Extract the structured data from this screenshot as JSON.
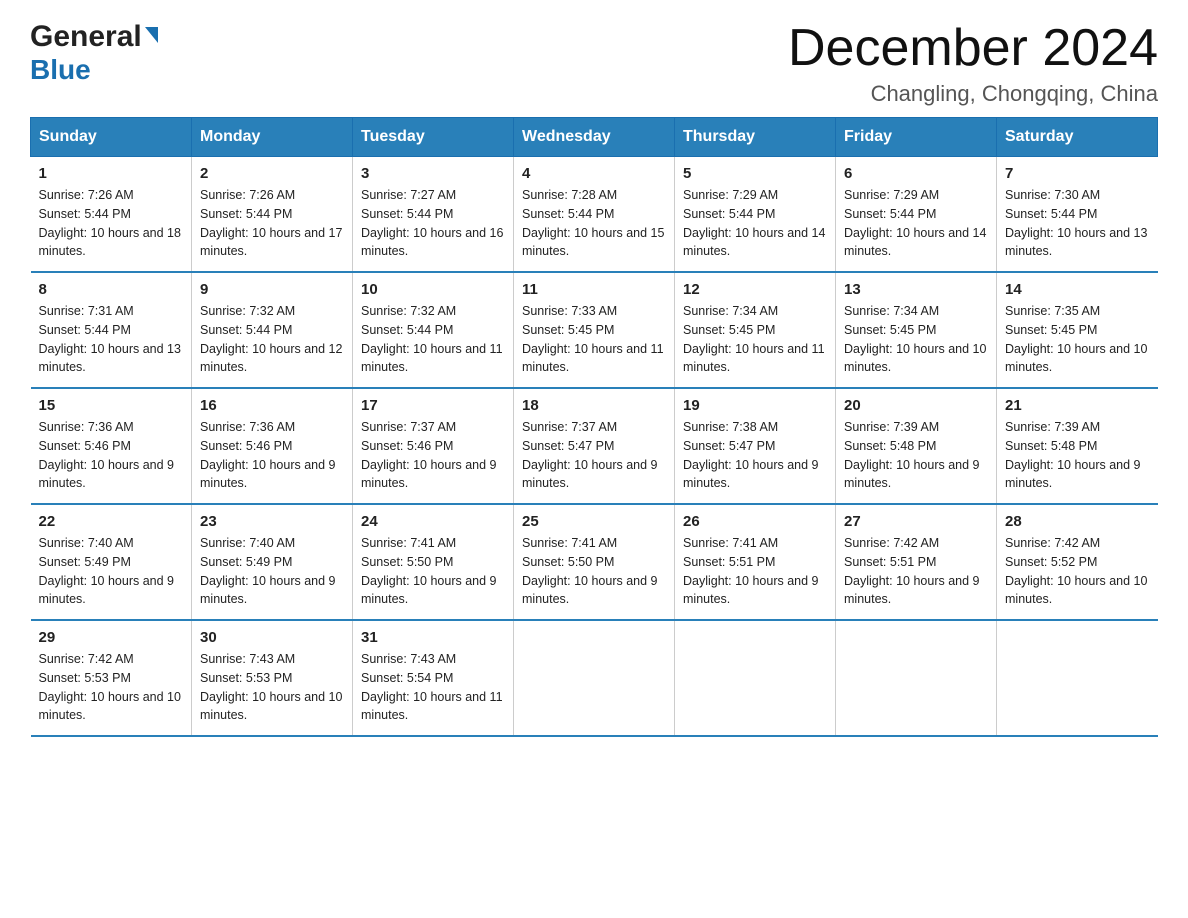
{
  "header": {
    "logo_general": "General",
    "logo_blue": "Blue",
    "month_title": "December 2024",
    "location": "Changling, Chongqing, China"
  },
  "days_of_week": [
    "Sunday",
    "Monday",
    "Tuesday",
    "Wednesday",
    "Thursday",
    "Friday",
    "Saturday"
  ],
  "weeks": [
    [
      {
        "day": "1",
        "sunrise": "7:26 AM",
        "sunset": "5:44 PM",
        "daylight": "10 hours and 18 minutes."
      },
      {
        "day": "2",
        "sunrise": "7:26 AM",
        "sunset": "5:44 PM",
        "daylight": "10 hours and 17 minutes."
      },
      {
        "day": "3",
        "sunrise": "7:27 AM",
        "sunset": "5:44 PM",
        "daylight": "10 hours and 16 minutes."
      },
      {
        "day": "4",
        "sunrise": "7:28 AM",
        "sunset": "5:44 PM",
        "daylight": "10 hours and 15 minutes."
      },
      {
        "day": "5",
        "sunrise": "7:29 AM",
        "sunset": "5:44 PM",
        "daylight": "10 hours and 14 minutes."
      },
      {
        "day": "6",
        "sunrise": "7:29 AM",
        "sunset": "5:44 PM",
        "daylight": "10 hours and 14 minutes."
      },
      {
        "day": "7",
        "sunrise": "7:30 AM",
        "sunset": "5:44 PM",
        "daylight": "10 hours and 13 minutes."
      }
    ],
    [
      {
        "day": "8",
        "sunrise": "7:31 AM",
        "sunset": "5:44 PM",
        "daylight": "10 hours and 13 minutes."
      },
      {
        "day": "9",
        "sunrise": "7:32 AM",
        "sunset": "5:44 PM",
        "daylight": "10 hours and 12 minutes."
      },
      {
        "day": "10",
        "sunrise": "7:32 AM",
        "sunset": "5:44 PM",
        "daylight": "10 hours and 11 minutes."
      },
      {
        "day": "11",
        "sunrise": "7:33 AM",
        "sunset": "5:45 PM",
        "daylight": "10 hours and 11 minutes."
      },
      {
        "day": "12",
        "sunrise": "7:34 AM",
        "sunset": "5:45 PM",
        "daylight": "10 hours and 11 minutes."
      },
      {
        "day": "13",
        "sunrise": "7:34 AM",
        "sunset": "5:45 PM",
        "daylight": "10 hours and 10 minutes."
      },
      {
        "day": "14",
        "sunrise": "7:35 AM",
        "sunset": "5:45 PM",
        "daylight": "10 hours and 10 minutes."
      }
    ],
    [
      {
        "day": "15",
        "sunrise": "7:36 AM",
        "sunset": "5:46 PM",
        "daylight": "10 hours and 9 minutes."
      },
      {
        "day": "16",
        "sunrise": "7:36 AM",
        "sunset": "5:46 PM",
        "daylight": "10 hours and 9 minutes."
      },
      {
        "day": "17",
        "sunrise": "7:37 AM",
        "sunset": "5:46 PM",
        "daylight": "10 hours and 9 minutes."
      },
      {
        "day": "18",
        "sunrise": "7:37 AM",
        "sunset": "5:47 PM",
        "daylight": "10 hours and 9 minutes."
      },
      {
        "day": "19",
        "sunrise": "7:38 AM",
        "sunset": "5:47 PM",
        "daylight": "10 hours and 9 minutes."
      },
      {
        "day": "20",
        "sunrise": "7:39 AM",
        "sunset": "5:48 PM",
        "daylight": "10 hours and 9 minutes."
      },
      {
        "day": "21",
        "sunrise": "7:39 AM",
        "sunset": "5:48 PM",
        "daylight": "10 hours and 9 minutes."
      }
    ],
    [
      {
        "day": "22",
        "sunrise": "7:40 AM",
        "sunset": "5:49 PM",
        "daylight": "10 hours and 9 minutes."
      },
      {
        "day": "23",
        "sunrise": "7:40 AM",
        "sunset": "5:49 PM",
        "daylight": "10 hours and 9 minutes."
      },
      {
        "day": "24",
        "sunrise": "7:41 AM",
        "sunset": "5:50 PM",
        "daylight": "10 hours and 9 minutes."
      },
      {
        "day": "25",
        "sunrise": "7:41 AM",
        "sunset": "5:50 PM",
        "daylight": "10 hours and 9 minutes."
      },
      {
        "day": "26",
        "sunrise": "7:41 AM",
        "sunset": "5:51 PM",
        "daylight": "10 hours and 9 minutes."
      },
      {
        "day": "27",
        "sunrise": "7:42 AM",
        "sunset": "5:51 PM",
        "daylight": "10 hours and 9 minutes."
      },
      {
        "day": "28",
        "sunrise": "7:42 AM",
        "sunset": "5:52 PM",
        "daylight": "10 hours and 10 minutes."
      }
    ],
    [
      {
        "day": "29",
        "sunrise": "7:42 AM",
        "sunset": "5:53 PM",
        "daylight": "10 hours and 10 minutes."
      },
      {
        "day": "30",
        "sunrise": "7:43 AM",
        "sunset": "5:53 PM",
        "daylight": "10 hours and 10 minutes."
      },
      {
        "day": "31",
        "sunrise": "7:43 AM",
        "sunset": "5:54 PM",
        "daylight": "10 hours and 11 minutes."
      },
      null,
      null,
      null,
      null
    ]
  ],
  "labels": {
    "sunrise": "Sunrise:",
    "sunset": "Sunset:",
    "daylight": "Daylight:"
  }
}
